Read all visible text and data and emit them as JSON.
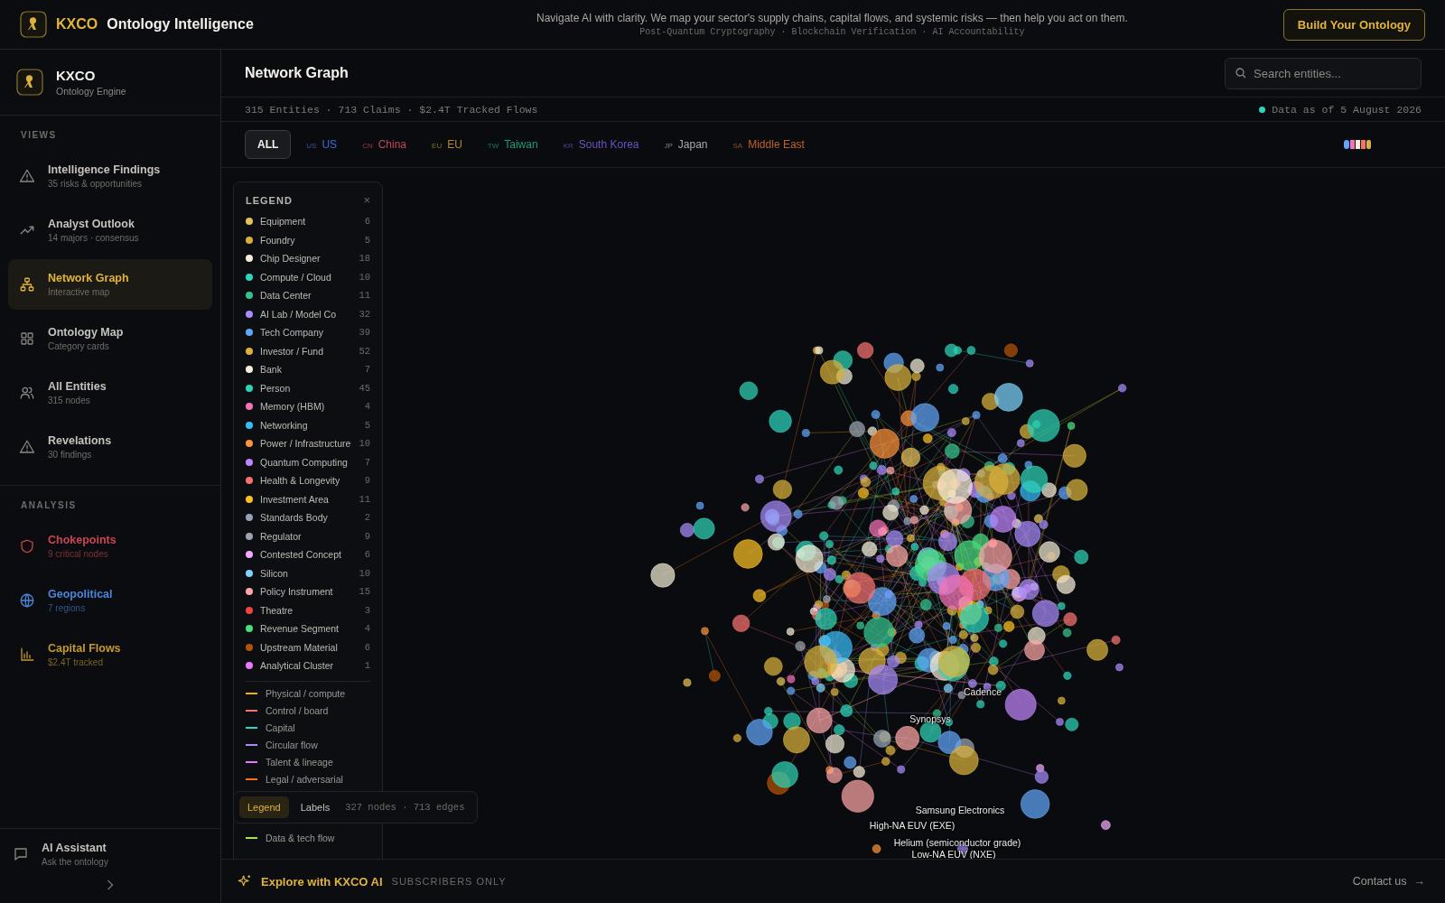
{
  "header": {
    "brand": "KXCO",
    "title": "Ontology Intelligence",
    "tagline": "Navigate AI with clarity. We map your sector's supply chains, capital flows, and systemic risks — then help you act on them.",
    "subtagline": "Post-Quantum Cryptography · Blockchain Verification · AI Accountability",
    "cta": "Build Your Ontology"
  },
  "sidebar": {
    "brand": "KXCO",
    "subtitle": "Ontology Engine",
    "sections": [
      {
        "title": "VIEWS",
        "items": [
          {
            "kind": "alert",
            "label": "Intelligence Findings",
            "sub": "35 risks & opportunities",
            "selected": false
          },
          {
            "kind": "trend",
            "label": "Analyst Outlook",
            "sub": "14 majors · consensus",
            "selected": false
          },
          {
            "kind": "network",
            "label": "Network Graph",
            "sub": "Interactive map",
            "selected": true
          },
          {
            "kind": "grid",
            "label": "Ontology Map",
            "sub": "Category cards",
            "selected": false
          },
          {
            "kind": "people",
            "label": "All Entities",
            "sub": "315 nodes",
            "selected": false
          },
          {
            "kind": "alert",
            "label": "Revelations",
            "sub": "30 findings",
            "selected": false
          }
        ]
      },
      {
        "title": "ANALYSIS",
        "items": [
          {
            "kind": "shield",
            "label": "Chokepoints",
            "sub": "9 critical nodes",
            "selected": false,
            "color": "#c9474f"
          },
          {
            "kind": "globe",
            "label": "Geopolitical",
            "sub": "7 regions",
            "selected": false,
            "color": "#4a86d8"
          },
          {
            "kind": "chart",
            "label": "Capital Flows",
            "sub": "$2.4T tracked",
            "selected": false,
            "color": "#c49a2c"
          }
        ]
      }
    ],
    "assistant": {
      "label": "AI Assistant",
      "sub": "Ask the ontology"
    }
  },
  "page": {
    "title": "Network Graph",
    "search": {
      "placeholder": "Search entities..."
    },
    "stats": "315 Entities · 713 Claims · $2.4T Tracked Flows",
    "data_date": "Data as of 5 August 2026"
  },
  "regions": [
    {
      "label": "ALL",
      "selected": true
    },
    {
      "code": "US",
      "label": "US",
      "color": "#3f6fd1",
      "selected": false
    },
    {
      "code": "CN",
      "label": "China",
      "color": "#c2455a",
      "selected": false
    },
    {
      "code": "EU",
      "label": "EU",
      "color": "#b48d2a",
      "selected": false
    },
    {
      "code": "TW",
      "label": "Taiwan",
      "color": "#1f9a78",
      "selected": false
    },
    {
      "code": "KR",
      "label": "South Korea",
      "color": "#6a52c4",
      "selected": false
    },
    {
      "code": "JP",
      "label": "Japan",
      "color": "#a9a9a9",
      "selected": false
    },
    {
      "code": "SA",
      "label": "Middle East",
      "color": "#c0622c",
      "selected": false
    }
  ],
  "legend": {
    "title": "LEGEND",
    "close": "×",
    "node_types": [
      {
        "label": "Equipment",
        "count": "6",
        "color": "#e4c35c"
      },
      {
        "label": "Foundry",
        "count": "5",
        "color": "#d6b03a"
      },
      {
        "label": "Chip Designer",
        "count": "18",
        "color": "#f3ecd6"
      },
      {
        "label": "Compute / Cloud",
        "count": "10",
        "color": "#2dd4bf"
      },
      {
        "label": "Data Center",
        "count": "11",
        "color": "#34c38f"
      },
      {
        "label": "AI Lab / Model Co",
        "count": "32",
        "color": "#a78bfa"
      },
      {
        "label": "Tech Company",
        "count": "39",
        "color": "#60a5fa"
      },
      {
        "label": "Investor / Fund",
        "count": "52",
        "color": "#d9b13c"
      },
      {
        "label": "Bank",
        "count": "7",
        "color": "#f6efd9"
      },
      {
        "label": "Person",
        "count": "45",
        "color": "#2ed3b6"
      },
      {
        "label": "Memory (HBM)",
        "count": "4",
        "color": "#f472b6"
      },
      {
        "label": "Networking",
        "count": "5",
        "color": "#38bdf8"
      },
      {
        "label": "Power / Infrastructure",
        "count": "10",
        "color": "#fb923c"
      },
      {
        "label": "Quantum Computing",
        "count": "7",
        "color": "#c084fc"
      },
      {
        "label": "Health & Longevity",
        "count": "9",
        "color": "#f87171"
      },
      {
        "label": "Investment Area",
        "count": "11",
        "color": "#fbbf24"
      },
      {
        "label": "Standards Body",
        "count": "2",
        "color": "#94a3b8"
      },
      {
        "label": "Regulator",
        "count": "9",
        "color": "#9ca3af"
      },
      {
        "label": "Contested Concept",
        "count": "6",
        "color": "#f0abfc"
      },
      {
        "label": "Silicon",
        "count": "10",
        "color": "#7dd3fc"
      },
      {
        "label": "Policy Instrument",
        "count": "15",
        "color": "#fca5a5"
      },
      {
        "label": "Theatre",
        "count": "3",
        "color": "#ef4444"
      },
      {
        "label": "Revenue Segment",
        "count": "4",
        "color": "#4ade80"
      },
      {
        "label": "Upstream Material",
        "count": "6",
        "color": "#b45309"
      },
      {
        "label": "Analytical Cluster",
        "count": "1",
        "color": "#e879f9"
      }
    ],
    "edge_types": [
      {
        "label": "Physical / compute",
        "color": "#eab308"
      },
      {
        "label": "Control / board",
        "color": "#f87171"
      },
      {
        "label": "Capital",
        "color": "#2dd4bf"
      },
      {
        "label": "Circular flow",
        "color": "#a78bfa"
      },
      {
        "label": "Talent & lineage",
        "color": "#e879f9"
      },
      {
        "label": "Legal / adversarial",
        "color": "#f97316"
      },
      {
        "label": "Data & tech flow",
        "color": "#a3e635"
      }
    ]
  },
  "toolbar": {
    "buttons": [
      {
        "label": "Legend",
        "selected": true
      },
      {
        "label": "Labels",
        "selected": false
      }
    ],
    "summary": "327 nodes · 713 edges"
  },
  "graph": {
    "labels": [
      "Cadence",
      "Synopsys",
      "Samsung Electronics",
      "High-NA EUV (EXE)",
      "Helium (semiconductor grade)",
      "Low-NA EUV (NXE)"
    ]
  },
  "footer": {
    "title": "Explore with KXCO AI",
    "badge": "SUBSCRIBERS ONLY",
    "contact": "Contact us",
    "arrow": "→"
  }
}
